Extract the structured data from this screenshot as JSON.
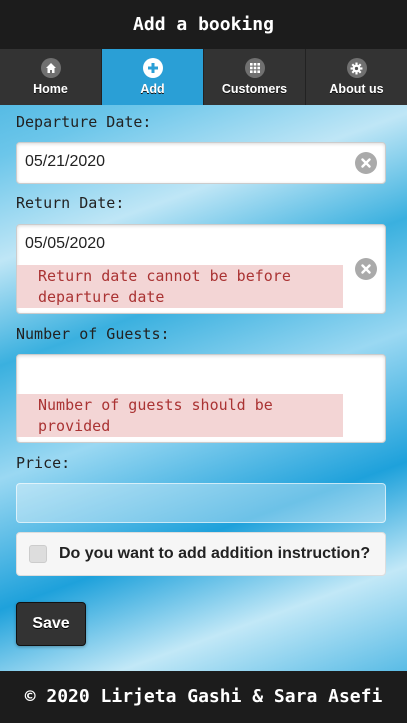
{
  "header": {
    "title": "Add a booking"
  },
  "nav": {
    "items": [
      {
        "label": "Home",
        "icon": "home-icon"
      },
      {
        "label": "Add",
        "icon": "plus-icon"
      },
      {
        "label": "Customers",
        "icon": "grid-icon"
      },
      {
        "label": "About us",
        "icon": "gear-icon"
      }
    ],
    "active": "Add"
  },
  "form": {
    "departure": {
      "label": "Departure Date:",
      "value": "05/21/2020"
    },
    "return": {
      "label": "Return Date:",
      "value": "05/05/2020",
      "error": "Return date cannot be before departure date"
    },
    "guests": {
      "label": "Number of Guests:",
      "value": "",
      "error": "Number of guests should be provided"
    },
    "price": {
      "label": "Price:",
      "value": ""
    },
    "instruction": {
      "label": "Do you want to add addition instruction?"
    },
    "save_label": "Save"
  },
  "footer": {
    "text": "© 2020 Lirjeta Gashi & Sara Asefi"
  },
  "colors": {
    "accent": "#2a9fd6",
    "error_bg": "#f3d5d5",
    "error_text": "#a33333"
  }
}
